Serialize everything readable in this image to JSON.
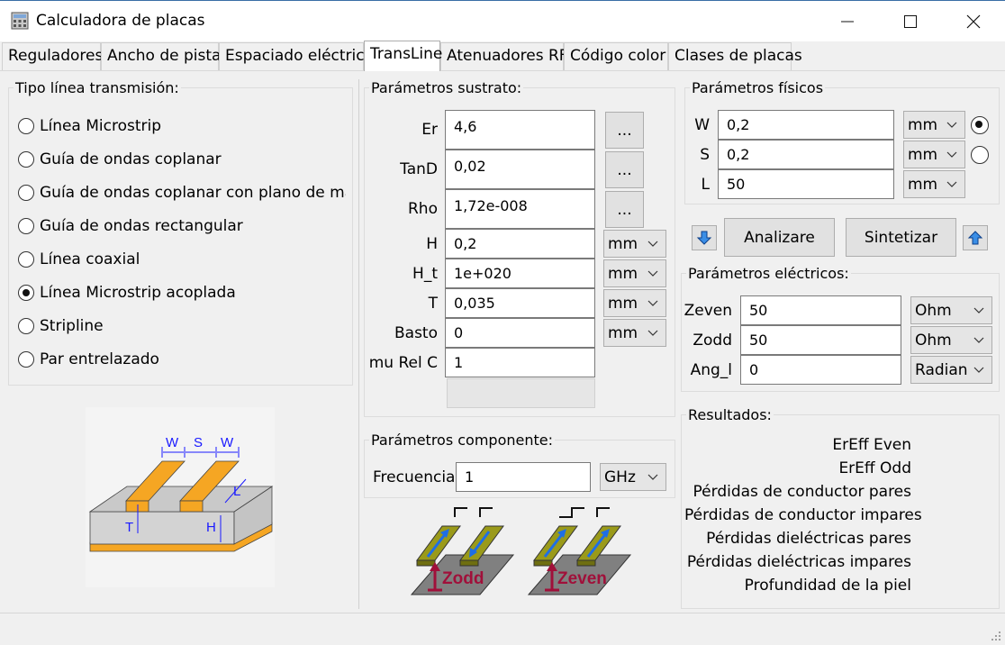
{
  "window": {
    "title": "Calculadora de placas"
  },
  "tabs": [
    "Reguladores",
    "Ancho de pista",
    "Espaciado eléctrico",
    "TransLine",
    "Atenuadores RF",
    "Código color",
    "Clases de placas"
  ],
  "line_types": {
    "title": "Tipo línea transmisión:",
    "options": [
      "Línea Microstrip",
      "Guía de ondas coplanar",
      "Guía de ondas coplanar con plano de masa",
      "Guía de ondas rectangular",
      "Línea coaxial",
      "Línea Microstrip acoplada",
      "Stripline",
      "Par entrelazado"
    ],
    "selected_index": 5
  },
  "diagram_labels": {
    "w1": "W",
    "s": "S",
    "w2": "W",
    "l": "L",
    "t": "T",
    "h": "H"
  },
  "substrate": {
    "title": "Parámetros sustrato:",
    "ellipsis": "...",
    "rows": [
      {
        "label": "Er",
        "value": "4,6"
      },
      {
        "label": "TanD",
        "value": "0,02"
      },
      {
        "label": "Rho",
        "value": "1,72e-008"
      },
      {
        "label": "H",
        "value": "0,2",
        "unit": "mm"
      },
      {
        "label": "H_t",
        "value": "1e+020",
        "unit": "mm"
      },
      {
        "label": "T",
        "value": "0,035",
        "unit": "mm"
      },
      {
        "label": "Basto",
        "value": "0",
        "unit": "mm"
      },
      {
        "label": "mu Rel C",
        "value": "1"
      }
    ]
  },
  "component": {
    "title": "Parámetros componente:",
    "label": "Frecuencia",
    "value": "1",
    "unit": "GHz"
  },
  "mode_labels": {
    "odd": "Zodd",
    "even": "Zeven"
  },
  "physical": {
    "title": "Parámetros físicos",
    "rows": [
      {
        "label": "W",
        "value": "0,2",
        "unit": "mm"
      },
      {
        "label": "S",
        "value": "0,2",
        "unit": "mm"
      },
      {
        "label": "L",
        "value": "50",
        "unit": "mm"
      }
    ],
    "radio_selected": 0
  },
  "actions": {
    "analyze": "Analizare",
    "synthesize": "Sintetizar"
  },
  "electrical": {
    "title": "Parámetros eléctricos:",
    "rows": [
      {
        "label": "Zeven",
        "value": "50",
        "unit": "Ohm"
      },
      {
        "label": "Zodd",
        "value": "50",
        "unit": "Ohm"
      },
      {
        "label": "Ang_l",
        "value": "0",
        "unit": "Radian"
      }
    ]
  },
  "results": {
    "title": "Resultados:",
    "items": [
      "ErEff Even",
      "ErEff Odd",
      "Pérdidas de conductor pares",
      "Pérdidas de conductor impares",
      "Pérdidas dieléctricas pares",
      "Pérdidas dieléctricas impares",
      "Profundidad de la piel"
    ]
  },
  "colors": {
    "strip": "#f5a623",
    "substrate": "#d3d3d3",
    "label_blue": "#1a1aff",
    "mode_red": "#a0103a",
    "mode_strip": "#9a9a1a",
    "arrow_blue": "#1e6ee6"
  }
}
